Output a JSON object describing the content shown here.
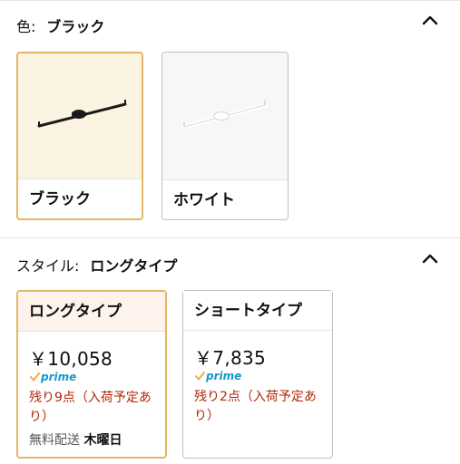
{
  "color_section": {
    "label": "色:",
    "selected_value": "ブラック",
    "options": [
      {
        "name": "ブラック",
        "selected": true
      },
      {
        "name": "ホワイト",
        "selected": false
      }
    ]
  },
  "style_section": {
    "label": "スタイル:",
    "selected_value": "ロングタイプ",
    "options": [
      {
        "name": "ロングタイプ",
        "price": "￥10,058",
        "prime": "prime",
        "stock": "残り9点（入荷予定あり）",
        "shipping_label": "無料配送",
        "shipping_day": "木曜日",
        "selected": true
      },
      {
        "name": "ショートタイプ",
        "price": "￥7,835",
        "prime": "prime",
        "stock": "残り2点（入荷予定あり）",
        "selected": false
      }
    ]
  },
  "colors": {
    "selected_border": "#e4b664",
    "price_stock": "#b12704",
    "prime_blue": "#1399c6"
  }
}
